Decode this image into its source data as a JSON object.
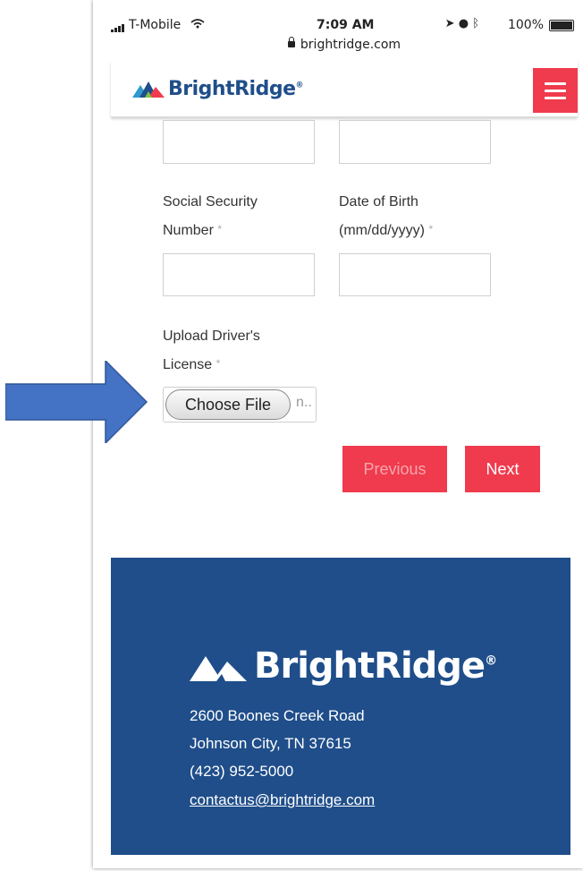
{
  "status_bar": {
    "carrier": "T-Mobile",
    "time": "7:09 AM",
    "battery": "100%",
    "url": "brightridge.com"
  },
  "header": {
    "brand": "BrightRidge",
    "registered": "®",
    "menu_icon": "hamburger-icon"
  },
  "form": {
    "ssn_label_line1": "Social Security",
    "ssn_label_line2": "Number",
    "dob_label_line1": "Date of Birth",
    "dob_label_line2": "(mm/dd/yyyy)",
    "license_label_line1": "Upload Driver's",
    "license_label_line2": "License",
    "required_mark": "*",
    "choose_file_label": "Choose File",
    "no_file_text": "n..",
    "previous_label": "Previous",
    "next_label": "Next"
  },
  "footer": {
    "brand": "BrightRidge",
    "registered": "®",
    "address_line1": "2600 Boones Creek Road",
    "address_line2": "Johnson City, TN 37615",
    "phone": "(423) 952-5000",
    "email": "contactus@brightridge.com"
  },
  "colors": {
    "brand_blue": "#1f4e8a",
    "accent_red": "#ef3b4d",
    "arrow_blue": "#4472c4"
  }
}
